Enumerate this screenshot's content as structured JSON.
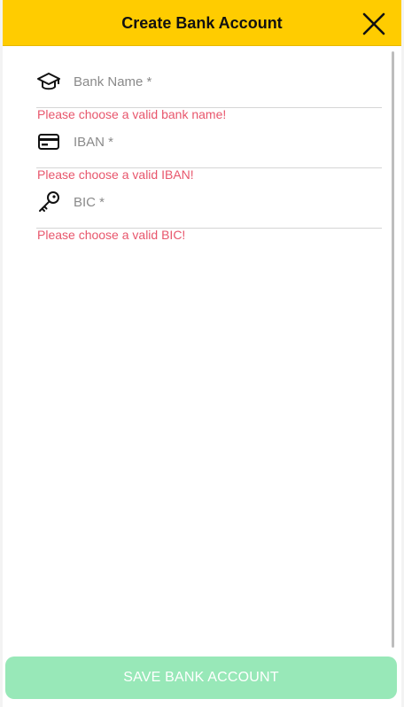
{
  "header": {
    "title": "Create Bank Account",
    "close_icon": "close-icon"
  },
  "form": {
    "bank_name": {
      "icon": "graduation-cap-icon",
      "placeholder": "Bank Name *",
      "value": "",
      "error": "Please choose a valid bank name!"
    },
    "iban": {
      "icon": "credit-card-icon",
      "placeholder": "IBAN *",
      "value": "",
      "error": "Please choose a valid IBAN!"
    },
    "bic": {
      "icon": "key-icon",
      "placeholder": "BIC *",
      "value": "",
      "error": "Please choose a valid BIC!"
    }
  },
  "footer": {
    "save_label": "SAVE BANK ACCOUNT"
  },
  "colors": {
    "header_bg": "#ffcc00",
    "error": "#e8566c",
    "save_button_disabled": "#98e8b8"
  }
}
